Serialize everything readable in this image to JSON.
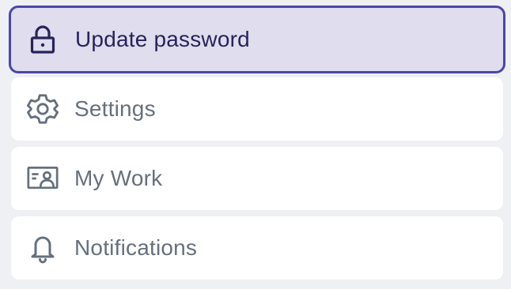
{
  "menu": {
    "items": [
      {
        "label": "Update password",
        "icon": "lock-icon",
        "active": true
      },
      {
        "label": "Settings",
        "icon": "gear-icon",
        "active": false
      },
      {
        "label": "My Work",
        "icon": "id-card-icon",
        "active": false
      },
      {
        "label": "Notifications",
        "icon": "bell-icon",
        "active": false
      }
    ]
  },
  "colors": {
    "background": "#eef0f4",
    "active_background": "#dfddee",
    "active_border": "#4b46a6",
    "active_text": "#28235a",
    "inactive_text": "#66707c"
  }
}
